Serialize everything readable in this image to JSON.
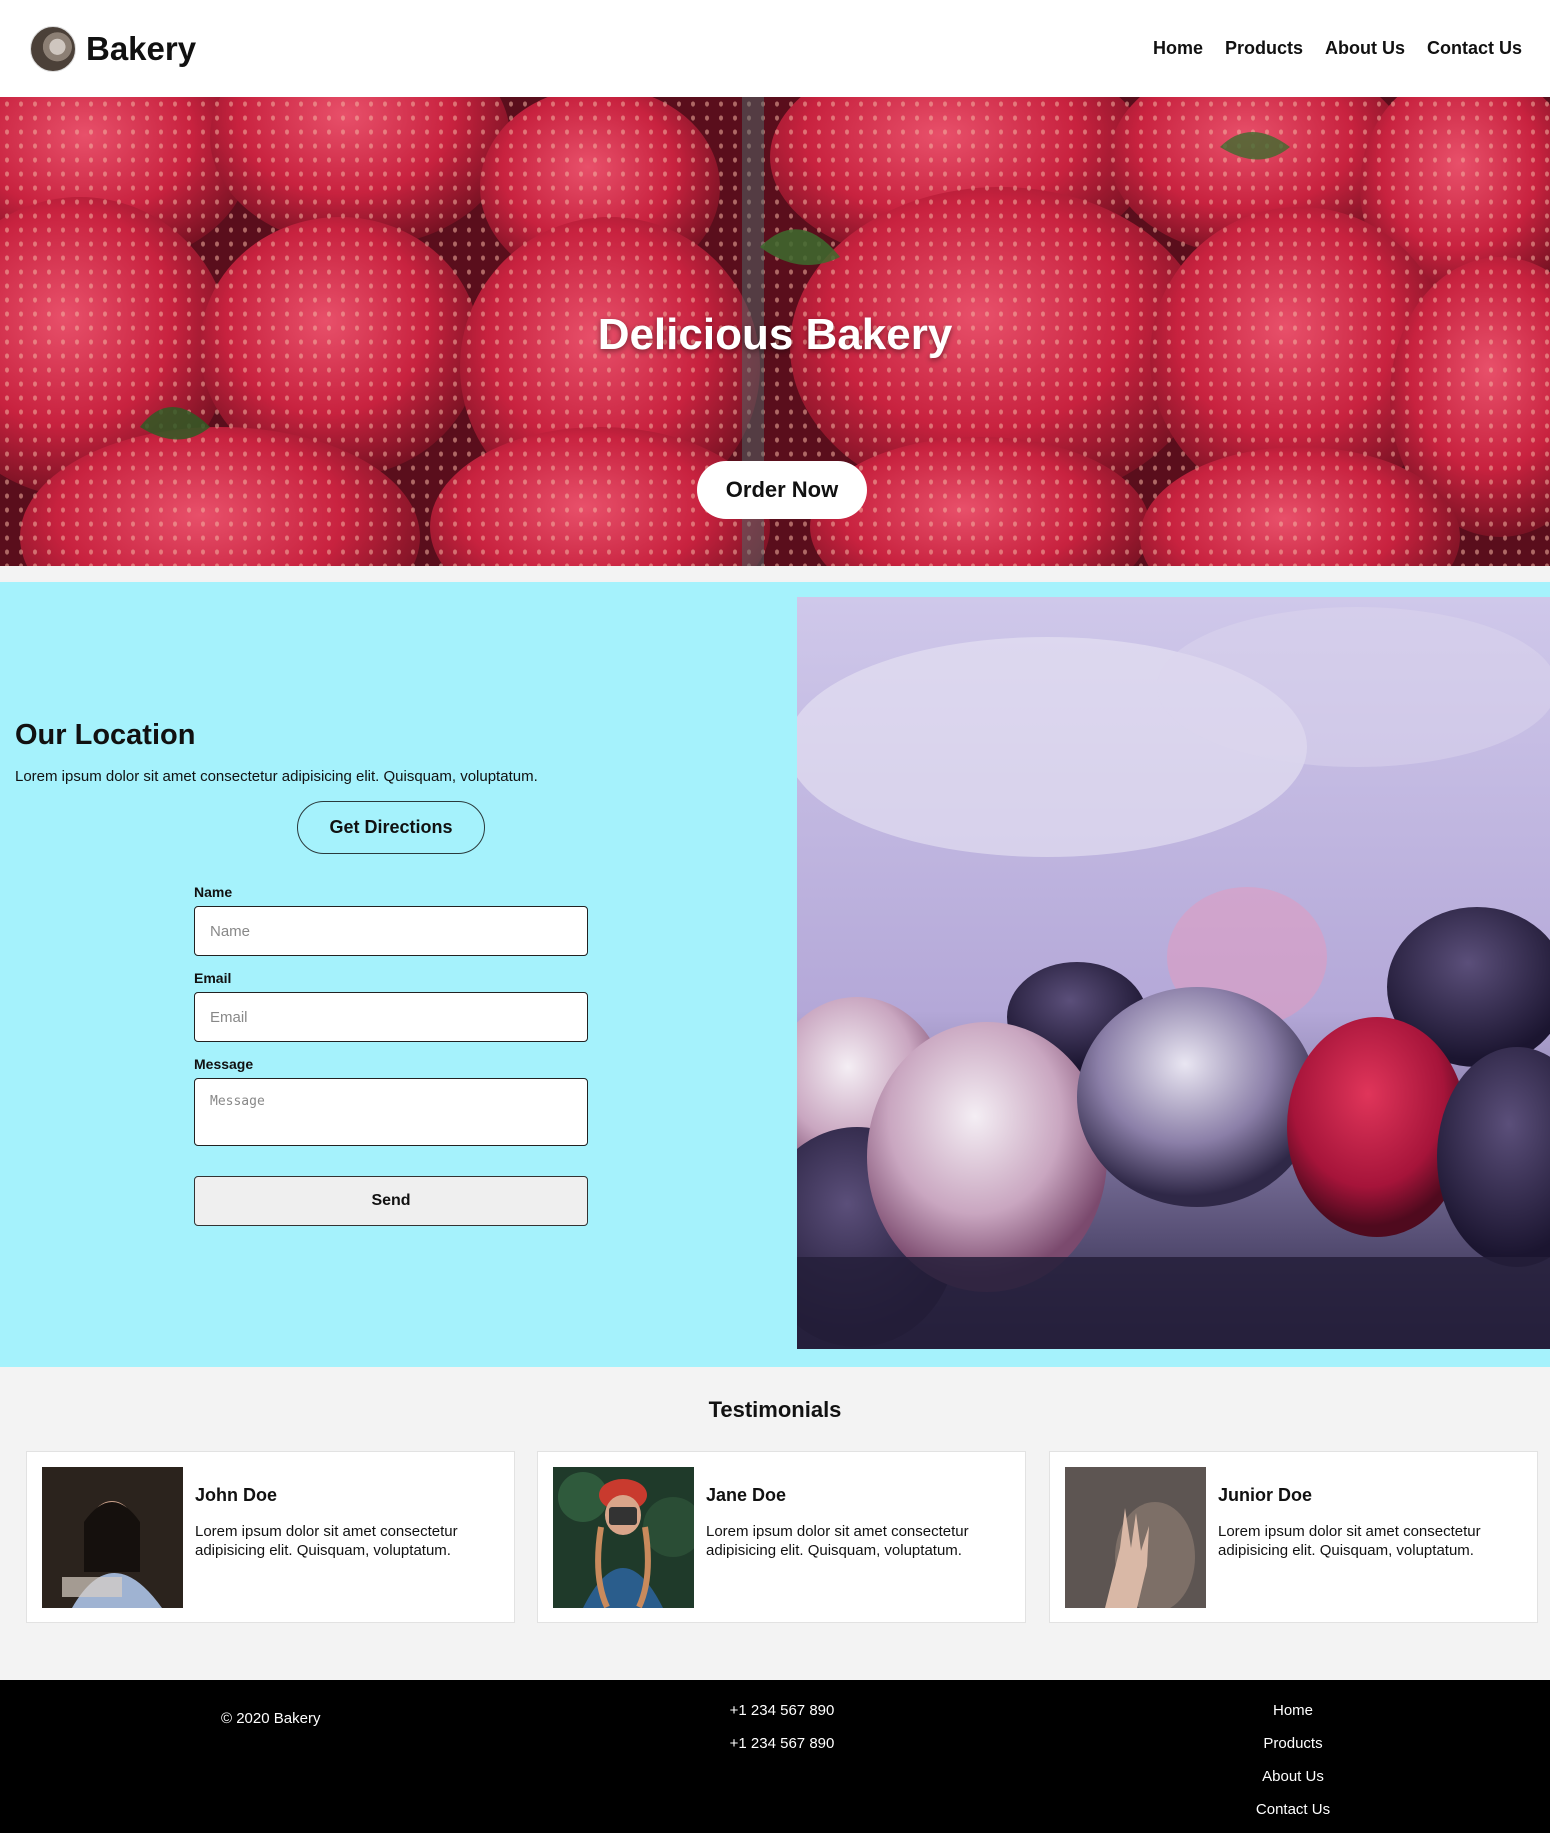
{
  "header": {
    "brand": "Bakery",
    "nav": [
      "Home",
      "Products",
      "About Us",
      "Contact Us"
    ]
  },
  "hero": {
    "title": "Delicious Bakery",
    "button": "Order Now"
  },
  "location": {
    "title": "Our Location",
    "text": "Lorem ipsum dolor sit amet consectetur adipisicing elit. Quisquam, voluptatum.",
    "directions_button": "Get Directions",
    "form": {
      "name_label": "Name",
      "name_placeholder": "Name",
      "email_label": "Email",
      "email_placeholder": "Email",
      "message_label": "Message",
      "message_placeholder": "Message",
      "send_button": "Send"
    }
  },
  "testimonials": {
    "title": "Testimonials",
    "items": [
      {
        "name": "John Doe",
        "text": "Lorem ipsum dolor sit amet consectetur adipisicing elit. Quisquam, voluptatum."
      },
      {
        "name": "Jane Doe",
        "text": "Lorem ipsum dolor sit amet consectetur adipisicing elit. Quisquam, voluptatum."
      },
      {
        "name": "Junior Doe",
        "text": "Lorem ipsum dolor sit amet consectetur adipisicing elit. Quisquam, voluptatum."
      }
    ]
  },
  "footer": {
    "copyright": "© 2020 Bakery",
    "phones": [
      "+1 234 567 890",
      "+1 234 567 890"
    ],
    "links": [
      "Home",
      "Products",
      "About Us",
      "Contact Us"
    ]
  },
  "colors": {
    "location_bg": "#a5f2fc",
    "footer_bg": "#000000",
    "page_bg": "#f3f3f3"
  }
}
